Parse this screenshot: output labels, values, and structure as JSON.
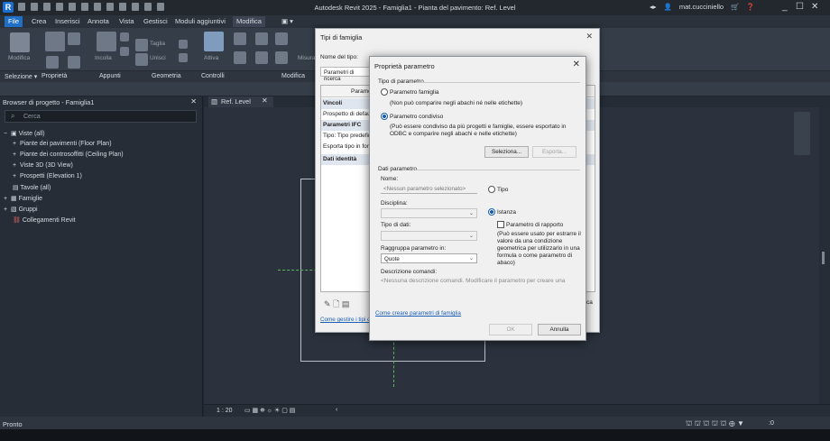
{
  "window": {
    "title": "Autodesk Revit 2025 - Famiglia1 - Pianta del pavimento: Ref. Level",
    "logo": "R",
    "user": "mat.cucciniello"
  },
  "menu": {
    "tabs": [
      "File",
      "Crea",
      "Inserisci",
      "Annota",
      "Vista",
      "Gestisci",
      "Moduli aggiuntivi",
      "Modifica"
    ]
  },
  "ribbon": {
    "groups": [
      "Modifica",
      "Incolla",
      "Taglia",
      "Unisci",
      "Attiva",
      "Misura"
    ],
    "footer": [
      "Selezione ▾",
      "Proprietà",
      "Appunti",
      "Geometria",
      "Controlli",
      "Modifica"
    ]
  },
  "browser": {
    "title": "Browser di progetto - Famiglia1",
    "search_placeholder": "Cerca",
    "items": [
      "Viste (all)",
      "Piante dei pavimenti (Floor Plan)",
      "Piante dei controsoffitti (Ceiling Plan)",
      "Viste 3D (3D View)",
      "Prospetti (Elevation 1)",
      "Tavole (all)",
      "Famiglie",
      "Gruppi",
      "Collegamenti Revit"
    ]
  },
  "view": {
    "tab_label": "Ref. Level",
    "scale": "1 : 20"
  },
  "status": {
    "text": "Pronto",
    "filter_count": ":0"
  },
  "type_dialog": {
    "title": "Tipi di famiglia",
    "type_name_label": "Nome del tipo:",
    "search_placeholder": "Parametri di ricerca",
    "col_param": "Parametro",
    "col_fa": "ca",
    "rows": [
      "Vincoli",
      "Prospetto di default",
      "Parametri IFC",
      "Tipo: Tipo predefinito",
      "Esporta tipo in formato",
      "Dati identità"
    ],
    "manage_link": "Come gestire i tipi di famiglia",
    "side_label": "ca"
  },
  "param_dialog": {
    "title": "Proprietà parametro",
    "section_type": "Tipo di parametro",
    "opt_family": "Parametro famiglia",
    "opt_family_desc": "(Non può comparire negli abachi né nelle etichette)",
    "opt_shared": "Parametro condiviso",
    "opt_shared_desc": "(Può essere condiviso da più progetti e famiglie, essere esportato in ODBC e comparire negli abachi e nelle etichette)",
    "btn_select": "Seleziona...",
    "btn_export": "Esporta...",
    "section_data": "Dati parametro",
    "name_label": "Nome:",
    "name_placeholder": "<Nessun parametro selezionato>",
    "opt_type": "Tipo",
    "discipline_label": "Disciplina:",
    "opt_instance": "Istanza",
    "data_type_label": "Tipo di dati:",
    "report_label": "Parametro di rapporto",
    "report_desc": "(Può essere usato per estrarre il valore da una condizione geometrica per utilizzarlo in una formula o come parametro di abaco)",
    "group_label": "Raggruppa parametro in:",
    "group_value": "Quote",
    "tooltip_label": "Descrizione comandi:",
    "tooltip_placeholder": "<Nessuna descrizione comandi. Modificare il parametro per creare una",
    "help_link": "Come creare parametri di famiglia",
    "btn_ok": "OK",
    "btn_cancel": "Annulla"
  },
  "colors": {
    "accent": "#1f6fc7",
    "selected_row": "#0078d7",
    "background": "#1f2630"
  }
}
